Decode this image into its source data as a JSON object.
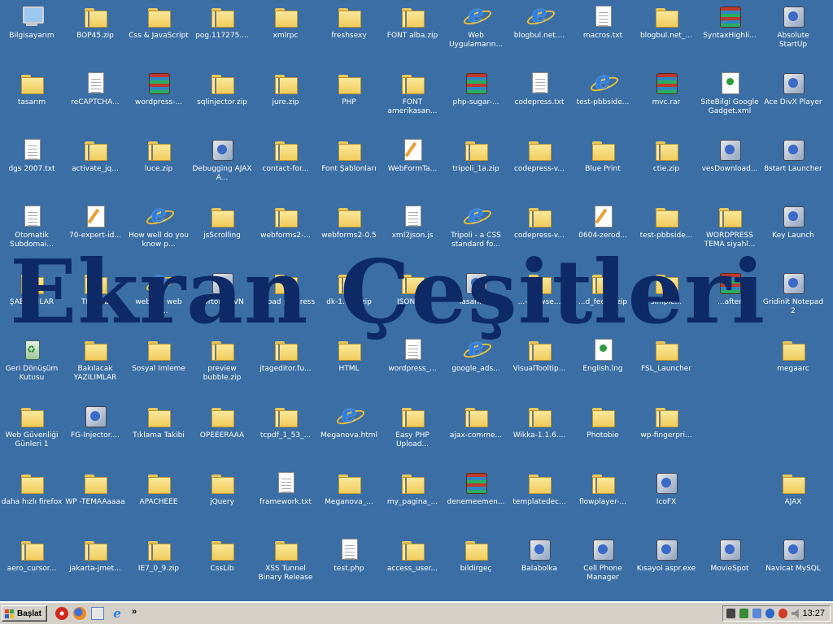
{
  "desktop": {
    "overlay_title": "Ekran Çeşitleri",
    "icons": [
      {
        "label": "Bilgisayarım",
        "type": "pc"
      },
      {
        "label": "BOP45.zip",
        "type": "zip"
      },
      {
        "label": "Css & JavaScript",
        "type": "folder"
      },
      {
        "label": "pog.117275....",
        "type": "zip"
      },
      {
        "label": "xmlrpc",
        "type": "folder"
      },
      {
        "label": "freshsexy",
        "type": "folder"
      },
      {
        "label": "FONT alba.zip",
        "type": "zip"
      },
      {
        "label": "Web Uygulamarın...",
        "type": "ie"
      },
      {
        "label": "blogbul.net....",
        "type": "ie"
      },
      {
        "label": "macros.txt",
        "type": "doc"
      },
      {
        "label": "blogbul.net_...",
        "type": "folder"
      },
      {
        "label": "SyntaxHighli...",
        "type": "rar"
      },
      {
        "label": "Absolute StartUp",
        "type": "app"
      },
      {
        "label": "tasarım",
        "type": "folder"
      },
      {
        "label": "reCAPTCHA...",
        "type": "doc"
      },
      {
        "label": "wordpress-...",
        "type": "rar"
      },
      {
        "label": "sqlinjector.zip",
        "type": "zip"
      },
      {
        "label": "jure.zip",
        "type": "zip"
      },
      {
        "label": "PHP",
        "type": "folder"
      },
      {
        "label": "FONT amerikasan...",
        "type": "zip"
      },
      {
        "label": "php-sugar-...",
        "type": "rar"
      },
      {
        "label": "codepress.txt",
        "type": "doc"
      },
      {
        "label": "test-pbbside...",
        "type": "ie"
      },
      {
        "label": "mvc.rar",
        "type": "rar"
      },
      {
        "label": "SiteBilgi Google Gadget.xml",
        "type": "cert"
      },
      {
        "label": "Ace DivX Player",
        "type": "app"
      },
      {
        "label": "dgs 2007.txt",
        "type": "doc"
      },
      {
        "label": "activate_jq...",
        "type": "zip"
      },
      {
        "label": "luce.zip",
        "type": "zip"
      },
      {
        "label": "Debugging AJAX A...",
        "type": "app"
      },
      {
        "label": "contact-for...",
        "type": "zip"
      },
      {
        "label": "Font Şablonları",
        "type": "folder"
      },
      {
        "label": "WebFormTa...",
        "type": "pen"
      },
      {
        "label": "tripoli_1a.zip",
        "type": "zip"
      },
      {
        "label": "codepress-v...",
        "type": "folder"
      },
      {
        "label": "Blue Print",
        "type": "folder"
      },
      {
        "label": "ctie.zip",
        "type": "zip"
      },
      {
        "label": "vesDownload...",
        "type": "app"
      },
      {
        "label": "8start Launcher",
        "type": "app"
      },
      {
        "label": "Otomatik Subdomai...",
        "type": "doc"
      },
      {
        "label": "70-expert-id...",
        "type": "pen"
      },
      {
        "label": "How well do you know p...",
        "type": "ie"
      },
      {
        "label": "jsScrolling",
        "type": "folder"
      },
      {
        "label": "webforms2-...",
        "type": "zip"
      },
      {
        "label": "webforms2-0.5",
        "type": "folder"
      },
      {
        "label": "xml2json.js",
        "type": "doc"
      },
      {
        "label": "Tripoli - a CSS standard fo...",
        "type": "ie"
      },
      {
        "label": "codepress-v...",
        "type": "zip"
      },
      {
        "label": "0604-zerod...",
        "type": "pen"
      },
      {
        "label": "test-pbbside...",
        "type": "folder"
      },
      {
        "label": "WORDPRESS TEMA siyahl...",
        "type": "zip"
      },
      {
        "label": "Key Launch",
        "type": "app"
      },
      {
        "label": "ŞABLONLAR",
        "type": "folder"
      },
      {
        "label": "TR-Web",
        "type": "folder"
      },
      {
        "label": "web 2.0 web 3.0...",
        "type": "ie"
      },
      {
        "label": "TortoiseSVN",
        "type": "app"
      },
      {
        "label": "upload progress",
        "type": "folder"
      },
      {
        "label": "dk-1.0b3.zip",
        "type": "zip"
      },
      {
        "label": "JSON.zip",
        "type": "zip"
      },
      {
        "label": "Tasarım...",
        "type": "app"
      },
      {
        "label": "...-browse...",
        "type": "zip"
      },
      {
        "label": "...d_feed...zip",
        "type": "zip"
      },
      {
        "label": "simple...",
        "type": "folder"
      },
      {
        "label": "...after",
        "type": "rar"
      },
      {
        "label": "Gridinit Notepad 2",
        "type": "app"
      },
      {
        "label": "Geri Dönüşüm Kutusu",
        "type": "trash"
      },
      {
        "label": "Bakılacak YAZILIMLAR",
        "type": "folder"
      },
      {
        "label": "Sosyal İmleme",
        "type": "folder"
      },
      {
        "label": "preview bubble.zip",
        "type": "zip"
      },
      {
        "label": "jtageditor.fu...",
        "type": "zip"
      },
      {
        "label": "HTML",
        "type": "folder"
      },
      {
        "label": "wordpress_...",
        "type": "doc"
      },
      {
        "label": "google_ads...",
        "type": "ie"
      },
      {
        "label": "VisualTooltip...",
        "type": "zip"
      },
      {
        "label": "English.lng",
        "type": "cert"
      },
      {
        "label": "FSL_Launcher",
        "type": "folder"
      },
      {
        "label": "megaarc",
        "type": "folder"
      },
      {
        "label": "Web Güvenliği Günleri 1",
        "type": "folder"
      },
      {
        "label": "FG-Injector....",
        "type": "app"
      },
      {
        "label": "Tıklama Takibi",
        "type": "folder"
      },
      {
        "label": "OPEEERAAA",
        "type": "folder"
      },
      {
        "label": "tcpdf_1_53_...",
        "type": "zip"
      },
      {
        "label": "Meganova.html",
        "type": "ie"
      },
      {
        "label": "Easy PHP Upload...",
        "type": "zip"
      },
      {
        "label": "ajax-comme...",
        "type": "zip"
      },
      {
        "label": "Wikka-1.1.6....",
        "type": "zip"
      },
      {
        "label": "Photobie",
        "type": "folder"
      },
      {
        "label": "wp-fingerpri...",
        "type": "zip"
      },
      {
        "label": "daha hızlı firefox",
        "type": "folder"
      },
      {
        "label": "WP -TEMAAaaaa",
        "type": "folder"
      },
      {
        "label": "APACHEEE",
        "type": "folder"
      },
      {
        "label": "jQuery",
        "type": "folder"
      },
      {
        "label": "framework.txt",
        "type": "doc"
      },
      {
        "label": "Meganova_...",
        "type": "folder"
      },
      {
        "label": "my_pagina_...",
        "type": "zip"
      },
      {
        "label": "denemeemen...",
        "type": "rar"
      },
      {
        "label": "templatedec...",
        "type": "folder"
      },
      {
        "label": "flowplayer-...",
        "type": "zip"
      },
      {
        "label": "IcoFX",
        "type": "app"
      },
      {
        "label": "AJAX",
        "type": "folder"
      },
      {
        "label": "aero_cursor...",
        "type": "zip"
      },
      {
        "label": "jakarta-jmet...",
        "type": "zip"
      },
      {
        "label": "IE7_0_9.zip",
        "type": "zip"
      },
      {
        "label": "CssLib",
        "type": "folder"
      },
      {
        "label": "XSS Tunnel Binary Release",
        "type": "folder"
      },
      {
        "label": "test.php",
        "type": "doc"
      },
      {
        "label": "access_user...",
        "type": "zip"
      },
      {
        "label": "bildirgeç",
        "type": "folder"
      },
      {
        "label": "Balabolka",
        "type": "app"
      },
      {
        "label": "Cell Phone Manager",
        "type": "app"
      },
      {
        "label": "Kısayol aspr.exe",
        "type": "app"
      },
      {
        "label": "MovieSpot",
        "type": "app"
      },
      {
        "label": "Navicat MySQL",
        "type": "app"
      }
    ]
  },
  "taskbar": {
    "start_label": "Başlat",
    "quick_launch": [
      "flash-icon",
      "firefox-icon",
      "show-desktop-icon",
      "ie-icon"
    ],
    "more_arrows": "»",
    "clock": "13:27"
  }
}
